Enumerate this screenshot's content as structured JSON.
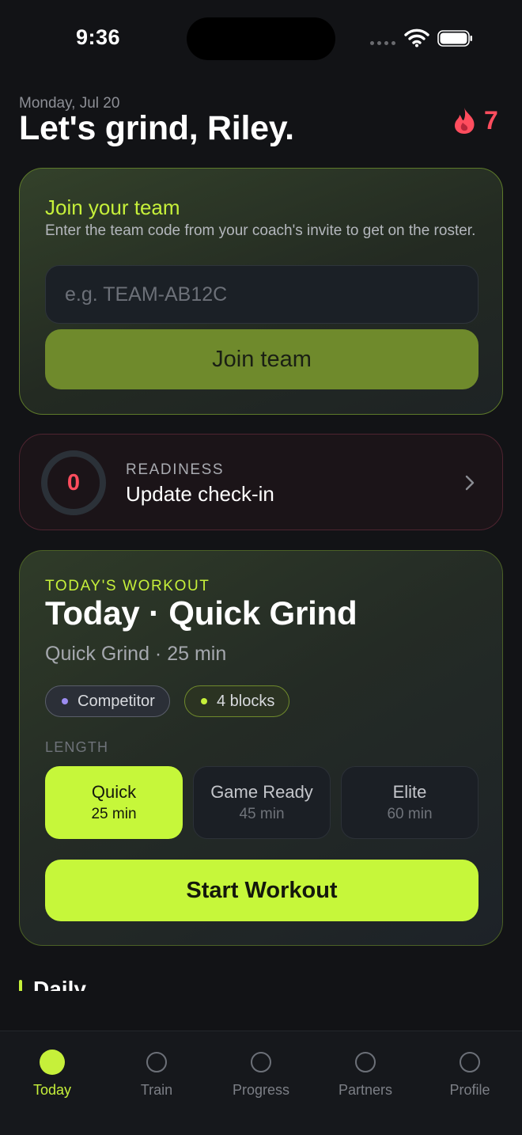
{
  "status_bar": {
    "time": "9:36"
  },
  "header": {
    "date": "Monday, Jul 20",
    "greeting": "Let's grind, Riley.",
    "streak_count": "7",
    "streak_icon": "flame-icon"
  },
  "join_team": {
    "title": "Join your team",
    "description": "Enter the team code from your coach's invite to get on the roster.",
    "input_value": "",
    "input_placeholder": "e.g. TEAM-AB12C",
    "button_label": "Join team"
  },
  "readiness": {
    "score": "0",
    "label": "READINESS",
    "action": "Update check-in"
  },
  "workout": {
    "eyebrow": "TODAY'S WORKOUT",
    "title": "Today · Quick Grind",
    "subtitle": "Quick Grind · 25 min",
    "chips": [
      {
        "label": "Competitor",
        "dot_color": "#9c8cf0"
      },
      {
        "label": "4 blocks",
        "dot_color": "#c6f03a"
      }
    ],
    "length_label": "LENGTH",
    "length_options": [
      {
        "name": "Quick",
        "duration": "25 min",
        "selected": true
      },
      {
        "name": "Game Ready",
        "duration": "45 min",
        "selected": false
      },
      {
        "name": "Elite",
        "duration": "60 min",
        "selected": false
      }
    ],
    "start_label": "Start Workout"
  },
  "daily_section": {
    "title": "Daily"
  },
  "tab_bar": {
    "active_color": "#c6f03a",
    "tabs": [
      {
        "label": "Today",
        "active": true
      },
      {
        "label": "Train",
        "active": false
      },
      {
        "label": "Progress",
        "active": false
      },
      {
        "label": "Partners",
        "active": false
      },
      {
        "label": "Profile",
        "active": false
      }
    ]
  },
  "colors": {
    "accent": "#c6f03a",
    "streak": "#ff4d5e",
    "background": "#121316"
  }
}
